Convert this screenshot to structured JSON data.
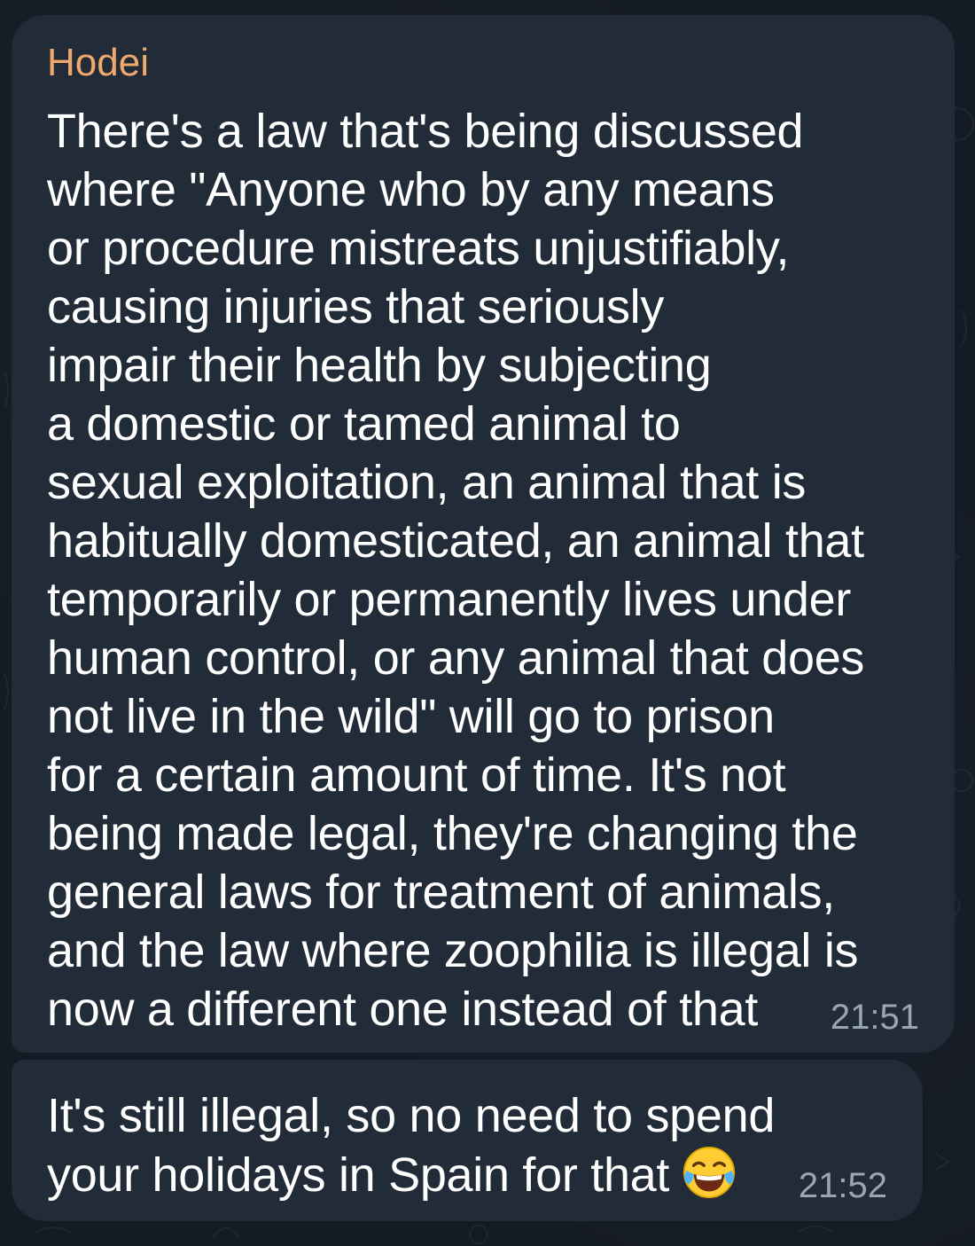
{
  "messages": [
    {
      "sender": "Hodei",
      "lines": [
        "There's a law that's being discussed",
        "where \"Anyone who by any means",
        "or procedure mistreats unjustifiably,",
        "causing injuries that seriously",
        "impair their health by subjecting",
        "a domestic or tamed animal to",
        "sexual exploitation, an animal that is",
        "habitually domesticated, an animal that",
        "temporarily or permanently lives under",
        "human control, or any animal that does",
        "not live in the wild\" will go to prison",
        "for a certain amount of time. It's not",
        "being made legal, they're changing the",
        "general laws for treatment of animals,",
        "and the law where zoophilia is illegal is",
        "now a different one instead of that"
      ],
      "time": "21:51"
    },
    {
      "lines": [
        "It's still illegal, so no need to spend",
        "your holidays in Spain for that"
      ],
      "emoji": "face-with-tears-of-joy-icon",
      "time": "21:52"
    }
  ],
  "colors": {
    "background": "#151b25",
    "bubble": "#222b38",
    "sender_name": "#f0a86d",
    "text": "#ffffff",
    "timestamp": "#9aa6b4"
  }
}
